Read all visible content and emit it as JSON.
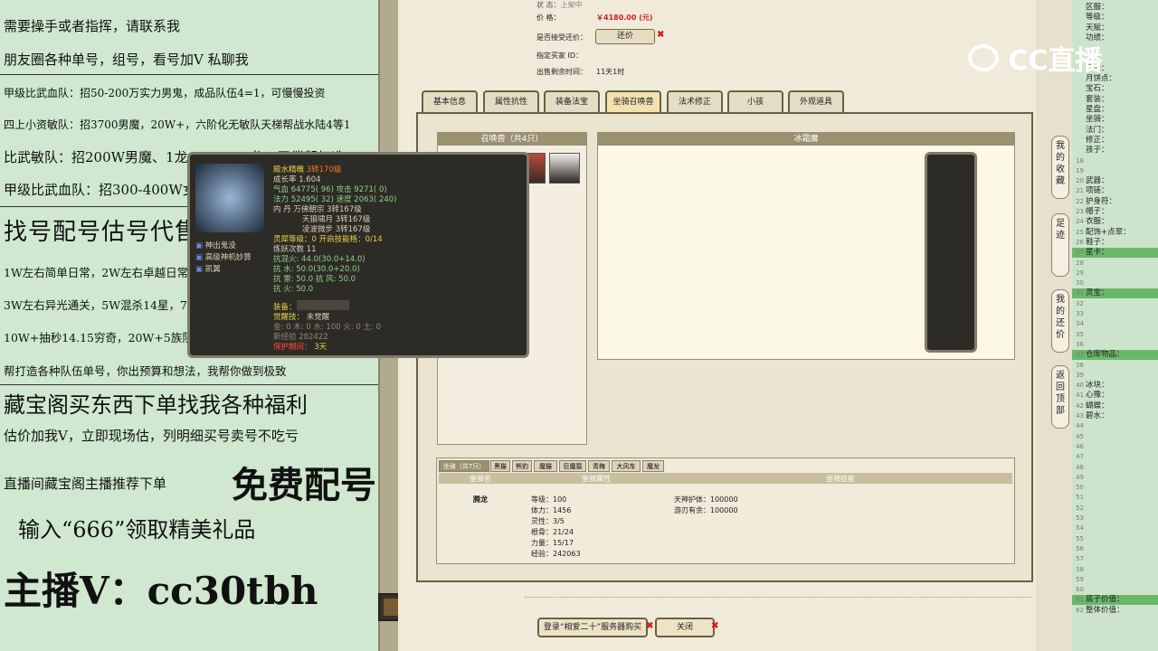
{
  "left_panel": {
    "lines": [
      "需要操手或者指挥，请联系我",
      "朋友圈各种单号，组号，看号加V 私聊我",
      "甲级比武血队：招50-200万实力男鬼，成品队伍4=1，可慢慢投资",
      "四上小资敏队：招3700男魔，20W+，六阶化无敏队天梯帮战水陆4等1",
      "比武敏队：招200W男魔、1龙、150W2龙，无偿帮打造",
      "甲级比武血队：招300-400W女魔，所有角色无偿帮打造",
      "找号配号估号代售，组号调整",
      "1W左右简单日常，2W左右卓越日常，炼狱地宫",
      "3W左右异光通关，5W混杀14星，7W大力队伍砍穷奇",
      "10W+抽秒14.15穷奇，20W+5族队伍轻松虐一切副本！",
      "帮打造各种队伍单号，你出预算和想法，我帮你做到极致",
      "藏宝阁买东西下单找我各种福利",
      "估价加我V，立即现场估，列明细买号卖号不吃亏",
      "直播间藏宝阁主播推荐下单",
      "免费配号",
      "输入“666”领取精美礼品",
      "主播V：cc30tbh"
    ]
  },
  "top_info": {
    "status_label": "状       态：",
    "status_value": "上架中",
    "price_label": "价       格：",
    "price_value": "￥4180.00 (元)",
    "bargain_label": "是否接受还价：",
    "bargain_button": "还价",
    "buyer_label": "指定买家 ID：",
    "remaining_label": "出售剩余时间：",
    "remaining_value": "11天1时"
  },
  "tabs": [
    "基本信息",
    "属性抗性",
    "装备法宝",
    "坐骑召唤兽",
    "法术修正",
    "小孩",
    "外观道具"
  ],
  "pet_list": {
    "header": "召唤兽（共4只）"
  },
  "pet_detail": {
    "header": "冰霜魔"
  },
  "tooltip": {
    "name": "殿水精魄",
    "level": "3转170级",
    "growth": "成长率 1.604",
    "hp": "气血 64775( 96) 攻击 9271( 0)",
    "mp": "法力 52495( 32) 速度 2063( 240)",
    "dan1": "内    丹  万佛朝宗  3转167级",
    "dan2": "天狼啸月  3转167级",
    "dan3": "凌波微步  3转167级",
    "spirit": "灵犀等级：0  开启技能格：0/14",
    "refine": "炼妖次数 11",
    "res1": "抗混火: 44.0(30.0+14.0)",
    "res2": "抗    水: 50.0(30.0+20.0)",
    "res3": "抗    雷: 50.0 抗    风: 50.0",
    "res4": "抗    火: 50.0",
    "equip": "装备：",
    "awaken": "觉醒技：",
    "awaken_value": "未觉醒",
    "elements": "金: 0 木: 0 水: 100 火: 0 土: 0",
    "exp": "新经验 282422",
    "protect": "保护期间：",
    "protect_value": "3天",
    "skills": [
      "神出鬼没",
      "高级神机妙算",
      "凯翼"
    ]
  },
  "mount": {
    "tabs": [
      "坐骑（共7只）",
      "黑猫",
      "熊豹",
      "魔猫",
      "巨魔猿",
      "青梅",
      "大风车",
      "魔龙"
    ],
    "col1": "坐骑名",
    "col2": "坐骑属性",
    "col3": "坐骑技能",
    "name": "腾龙",
    "stats": [
      "等级：100",
      "体力：1456",
      "灵性：3/5",
      "根骨：21/24",
      "力量：15/17",
      "经验：242063"
    ],
    "skills": [
      "天神护体：100000",
      "游刃有余：100000"
    ]
  },
  "bottom": {
    "login_button": "登录“相爱二十”服务器购买",
    "close_button": "关闭"
  },
  "side_buttons": [
    "我的收藏",
    "足迹",
    "我的还价",
    "返回顶部"
  ],
  "logo": "CC直播",
  "right_list": [
    {
      "n": "",
      "t": "区服："
    },
    {
      "n": "",
      "t": "等级："
    },
    {
      "n": "",
      "t": "天赋："
    },
    {
      "n": "",
      "t": "功绩："
    },
    {
      "n": "",
      "t": ""
    },
    {
      "n": "",
      "t": ""
    },
    {
      "n": "",
      "t": "门派："
    },
    {
      "n": "",
      "t": "月饼点："
    },
    {
      "n": "",
      "t": "宝石："
    },
    {
      "n": "",
      "t": "套装："
    },
    {
      "n": "",
      "t": "星盘："
    },
    {
      "n": "",
      "t": "坐骑："
    },
    {
      "n": "",
      "t": "法门："
    },
    {
      "n": "",
      "t": "修正："
    },
    {
      "n": "",
      "t": "孩子："
    },
    {
      "n": "18",
      "t": ""
    },
    {
      "n": "19",
      "t": ""
    },
    {
      "n": "20",
      "t": "武器："
    },
    {
      "n": "21",
      "t": "项链："
    },
    {
      "n": "22",
      "t": "护身符："
    },
    {
      "n": "23",
      "t": "帽子："
    },
    {
      "n": "24",
      "t": "衣服："
    },
    {
      "n": "25",
      "t": "配饰+点翠："
    },
    {
      "n": "26",
      "t": "鞋子："
    },
    {
      "n": "27",
      "t": "星卡：",
      "hl": true
    },
    {
      "n": "28",
      "t": ""
    },
    {
      "n": "29",
      "t": ""
    },
    {
      "n": "30",
      "t": ""
    },
    {
      "n": "31",
      "t": "灵宝：",
      "hl": true
    },
    {
      "n": "32",
      "t": ""
    },
    {
      "n": "33",
      "t": ""
    },
    {
      "n": "34",
      "t": ""
    },
    {
      "n": "35",
      "t": ""
    },
    {
      "n": "36",
      "t": ""
    },
    {
      "n": "37",
      "t": "仓库物品：",
      "hl": true
    },
    {
      "n": "38",
      "t": ""
    },
    {
      "n": "39",
      "t": ""
    },
    {
      "n": "40",
      "t": "冰块："
    },
    {
      "n": "41",
      "t": "心豫："
    },
    {
      "n": "42",
      "t": "蝴蝶："
    },
    {
      "n": "43",
      "t": "碧水："
    },
    {
      "n": "44",
      "t": ""
    },
    {
      "n": "45",
      "t": ""
    },
    {
      "n": "46",
      "t": ""
    },
    {
      "n": "47",
      "t": ""
    },
    {
      "n": "48",
      "t": ""
    },
    {
      "n": "49",
      "t": ""
    },
    {
      "n": "50",
      "t": ""
    },
    {
      "n": "51",
      "t": ""
    },
    {
      "n": "52",
      "t": ""
    },
    {
      "n": "53",
      "t": ""
    },
    {
      "n": "54",
      "t": ""
    },
    {
      "n": "55",
      "t": ""
    },
    {
      "n": "56",
      "t": ""
    },
    {
      "n": "57",
      "t": ""
    },
    {
      "n": "58",
      "t": ""
    },
    {
      "n": "59",
      "t": ""
    },
    {
      "n": "60",
      "t": ""
    },
    {
      "n": "61",
      "t": "底子价值：",
      "hl": true
    },
    {
      "n": "62",
      "t": "整体价值："
    }
  ],
  "colors": {
    "panel_green": "#cfe8cf",
    "highlight_green": "#6ab86a",
    "price_red": "#d42020",
    "tooltip_bg": "#2d2b25"
  }
}
